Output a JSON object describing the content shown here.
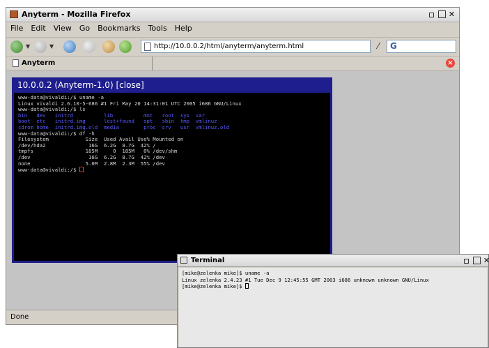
{
  "firefox": {
    "title": "Anyterm - Mozilla Firefox",
    "menu": [
      "File",
      "Edit",
      "View",
      "Go",
      "Bookmarks",
      "Tools",
      "Help"
    ],
    "url": "http://10.0.0.2/html/anyterm/anyterm.html",
    "tab_label": "Anyterm",
    "status": "Done"
  },
  "anyterm": {
    "title": "10.0.0.2 (Anyterm-1.0)",
    "close_label": "[close]",
    "lines": [
      "www-data@vivaldi:/$ uname -a",
      "Linux vivaldi 2.6.10-5-686 #1 Fri May 20 14:31:01 UTC 2005 i686 GNU/Linux",
      "www-data@vivaldi:/$ ls",
      "bin   dev   initrd          lib          mnt   root  sys  var",
      "boot  etc   initrd.img      lost+found   opt   sbin  tmp  vmlinuz",
      "cdrom home  initrd.img.old  media        proc  srv   usr  vmlinuz.old",
      "www-data@vivaldi:/$ df -h",
      "Filesystem            Size  Used Avail Use% Mounted on",
      "/dev/hda2              16G  6.2G  8.7G  42% /",
      "tmpfs                 185M     0  185M   0% /dev/shm",
      "/dev                   16G  6.2G  8.7G  42% /dev",
      "none                  5.0M  2.8M  2.3M  55% /dev"
    ],
    "prompt": "www-data@vivaldi:/$ "
  },
  "xterm": {
    "title": "Terminal",
    "lines": [
      "[mike@zelenka mike]$ uname -a",
      "Linux zelenka 2.4.23 #1 Tue Dec 9 12:45:55 GMT 2003 i686 unknown unknown GNU/Linux"
    ],
    "prompt": "[mike@zelenka mike]$ "
  }
}
